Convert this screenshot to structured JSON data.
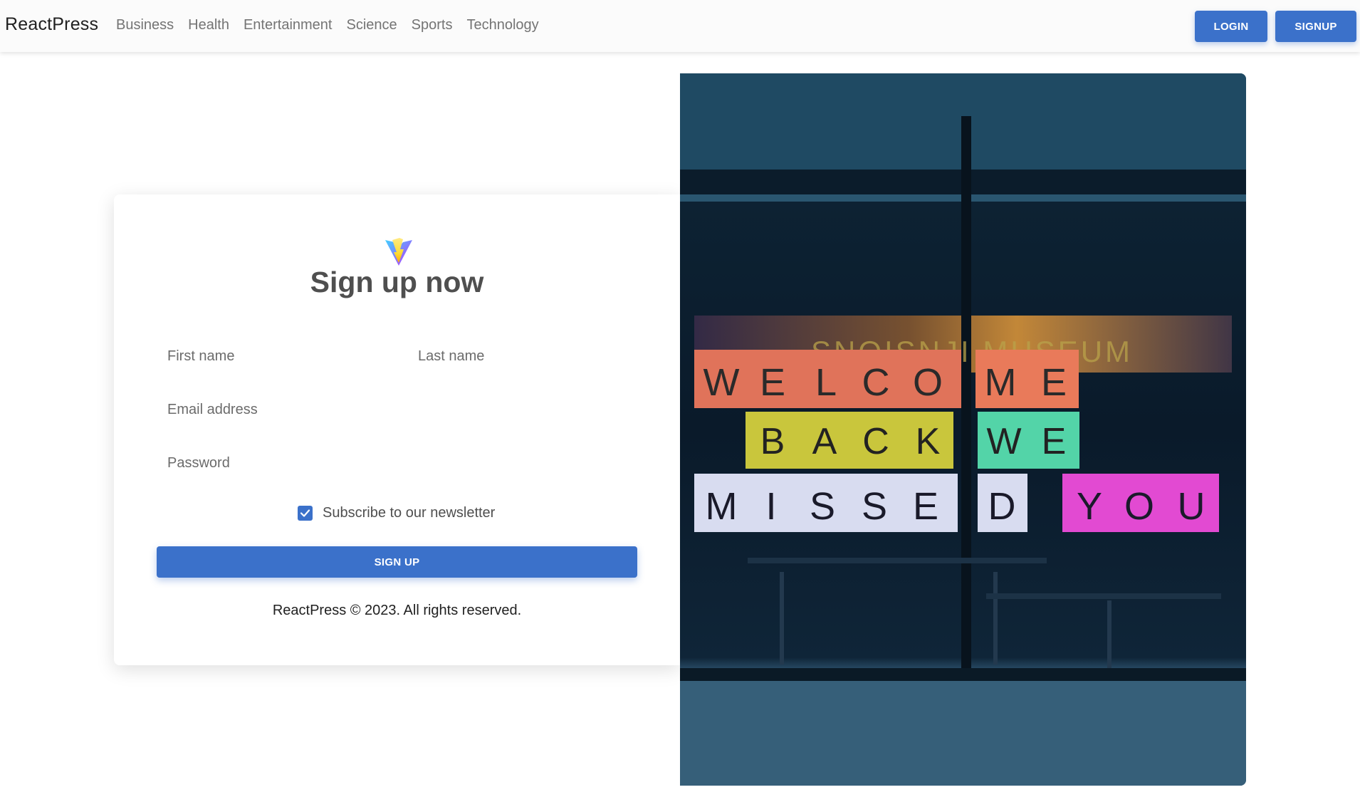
{
  "navbar": {
    "brand": "ReactPress",
    "links": [
      "Business",
      "Health",
      "Entertainment",
      "Science",
      "Sports",
      "Technology"
    ],
    "login_label": "LOGIN",
    "signup_label": "SIGNUP"
  },
  "form": {
    "title": "Sign up now",
    "first_name_placeholder": "First name",
    "last_name_placeholder": "Last name",
    "email_placeholder": "Email address",
    "password_placeholder": "Password",
    "newsletter_label": "Subscribe to our newsletter",
    "newsletter_checked": true,
    "submit_label": "SIGN UP",
    "copyright": "ReactPress © 2023. All rights reserved."
  },
  "photo": {
    "rows": [
      [
        "W",
        "E",
        "L",
        "C",
        "O",
        "M",
        "E"
      ],
      [
        "B",
        "A",
        "C",
        "K",
        "W",
        "E"
      ],
      [
        "M",
        "I",
        "S",
        "S",
        "E",
        "D",
        "Y",
        "O",
        "U"
      ]
    ],
    "reflection": "SNOISNJI MUSEUM"
  },
  "colors": {
    "primary": "#3b71ca",
    "title": "#4f4f4f",
    "navbar_bg": "#fbfbfb",
    "nav_link": "#747474"
  }
}
